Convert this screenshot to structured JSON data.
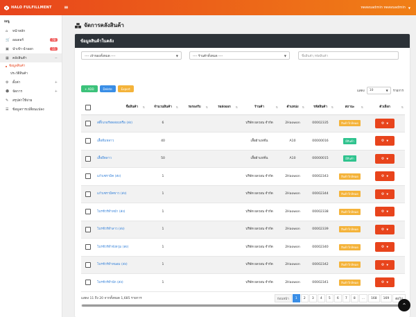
{
  "app": {
    "brand": "HALO FULFILLMENT",
    "user": "ทดสอบadmin ทดสอบadmin"
  },
  "sidebar": {
    "heading": "เมนู",
    "items": [
      {
        "label": "หน้าหลัก",
        "icon": "home-icon"
      },
      {
        "label": "ออเดอร์",
        "icon": "cart-icon",
        "badge": "78"
      },
      {
        "label": "นำเข้า-นำออก",
        "icon": "box-icon",
        "badge": "15"
      },
      {
        "label": "คลังสินค้า",
        "icon": "warehouse-icon",
        "active": true
      }
    ],
    "subitems": [
      {
        "label": "ข้อมูลสินค้า",
        "current": true
      },
      {
        "label": "ประวัติสินค้า"
      }
    ],
    "items2": [
      {
        "label": "ตั้งค่า",
        "icon": "gear-icon"
      },
      {
        "label": "จัดการ",
        "icon": "users-icon"
      },
      {
        "label": "สรุปค่าใช้จ่าย",
        "icon": "receipt-icon"
      },
      {
        "label": "ข้อมูลการเปลี่ยนแปลง",
        "icon": "history-icon"
      }
    ]
  },
  "page": {
    "title": "จัดการคลังสินค้า"
  },
  "card": {
    "title": "ข้อมูลสินค้าในคลัง"
  },
  "filters": {
    "owner": "---- เจ้าของทั้งหมด ----",
    "shop": "---- ร้านค้าทั้งหมด ----",
    "search_placeholder": "ชื่อสินค้า,รหัสสินค้า"
  },
  "buttons": {
    "add": "+ ADD",
    "delete": "Delete",
    "export": "Export"
  },
  "length": {
    "prefix": "แสดง",
    "value": "10",
    "suffix": "รายการ"
  },
  "table": {
    "headers": [
      "ชื่อสินค้า",
      "จำนวนสินค้า",
      "รอรองรับ",
      "รอส่งออก",
      "ร้านค้า",
      "ตำแหน่ง",
      "รหัสสินค้า",
      "สถานะ",
      "ตัวเลือก"
    ],
    "rows": [
      {
        "name": "สติ๊กเกอร์ทดสอบหรือ (ส่ง)",
        "qty": "6",
        "in": "",
        "out": "",
        "shop": "บริษัท ผลวอน จำกัด",
        "loc": "2Haowon",
        "code": "00002335",
        "status": "สินค้าใกล้หมด",
        "status_type": "orange"
      },
      {
        "name": "เสื้อทีมหลาว",
        "qty": "40",
        "in": "",
        "out": "",
        "shop": "เสื้อผ้าแฟชั่น",
        "loc": "A10",
        "code": "00000016",
        "status": "มีสินค้า",
        "status_type": "green"
      },
      {
        "name": "เสื้อยืดลาว",
        "qty": "50",
        "in": "",
        "out": "",
        "shop": "เสื้อผ้าแฟชั่น",
        "loc": "A10",
        "code": "00000015",
        "status": "มีสินค้า",
        "status_type": "green"
      },
      {
        "name": "แก้วเซรามิค (ส่ง)",
        "qty": "1",
        "in": "",
        "out": "",
        "shop": "บริษัท ผลวอน จำกัด",
        "loc": "2Haowon",
        "code": "00002343",
        "status": "สินค้าใกล้หมด",
        "status_type": "orange"
      },
      {
        "name": "แก้วเซรามิคขาว (ส่ง)",
        "qty": "1",
        "in": "",
        "out": "",
        "shop": "บริษัท ผลวอน จำกัด",
        "loc": "2Haowon",
        "code": "00002344",
        "status": "สินค้าใกล้หมด",
        "status_type": "orange"
      },
      {
        "name": "โบรชัวร์ทำหน้า (ส่ง)",
        "qty": "1",
        "in": "",
        "out": "",
        "shop": "บริษัท ผลวอน จำกัด",
        "loc": "2Haowon",
        "code": "00002338",
        "status": "สินค้าใกล้หมด",
        "status_type": "orange"
      },
      {
        "name": "โบรชัวร์ทำลาว (ส่ง)",
        "qty": "1",
        "in": "",
        "out": "",
        "shop": "บริษัท ผลวอน จำกัด",
        "loc": "2Haowon",
        "code": "00002339",
        "status": "สินค้าใกล้หมด",
        "status_type": "orange"
      },
      {
        "name": "โบรชัวร์ทำจังหวุม (ส่ง)",
        "qty": "1",
        "in": "",
        "out": "",
        "shop": "บริษัท ผลวอน จำกัด",
        "loc": "2Haowon",
        "code": "00002340",
        "status": "สินค้าใกล้หมด",
        "status_type": "orange"
      },
      {
        "name": "โบรชัวร์ทำหนอม (ส่ง)",
        "qty": "1",
        "in": "",
        "out": "",
        "shop": "บริษัท ผลวอน จำกัด",
        "loc": "2Haowon",
        "code": "00002342",
        "status": "สินค้าใกล้หมด",
        "status_type": "orange"
      },
      {
        "name": "โบรชัวร์ทำนัก (ส่ง)",
        "qty": "1",
        "in": "",
        "out": "",
        "shop": "บริษัท ผลวอน จำกัด",
        "loc": "2Haowon",
        "code": "00002341",
        "status": "สินค้าใกล้หมด",
        "status_type": "orange"
      }
    ]
  },
  "footer": {
    "info": "แสดง 11 ถึง 20 จากทั้งหมด 1,685 รายการ",
    "pages": [
      "ก่อนหน้า",
      "1",
      "2",
      "3",
      "4",
      "5",
      "6",
      "7",
      "8",
      "...",
      "168",
      "169",
      "ต่อไป"
    ],
    "current": "1"
  },
  "colors": {
    "brand": "#e8441c",
    "header_dark": "#2c3238",
    "link": "#2f7ed8"
  }
}
